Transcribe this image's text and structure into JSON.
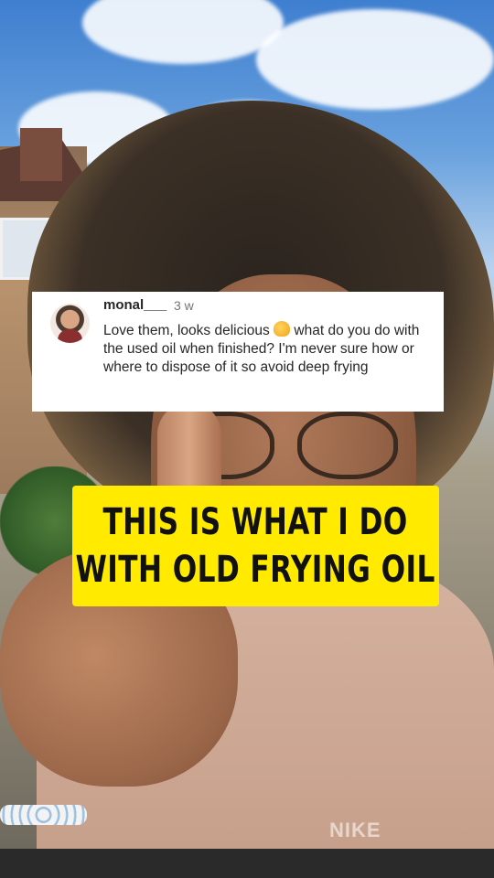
{
  "comment": {
    "username": "monal___",
    "time": "3 w",
    "text_before_emoji": "Love them, looks delicious ",
    "emoji_icon": "waving-hand-icon",
    "text_after_emoji": " what do you do with the used oil when finished? I'm never sure how or where to dispose of it so avoid deep frying"
  },
  "caption": {
    "line1": "THIS IS WHAT I DO",
    "line2": "WITH OLD FRYING OIL"
  },
  "background": {
    "hoodie_brand": "NIKE"
  },
  "colors": {
    "caption_background": "#ffea00",
    "card_background": "#ffffff"
  }
}
